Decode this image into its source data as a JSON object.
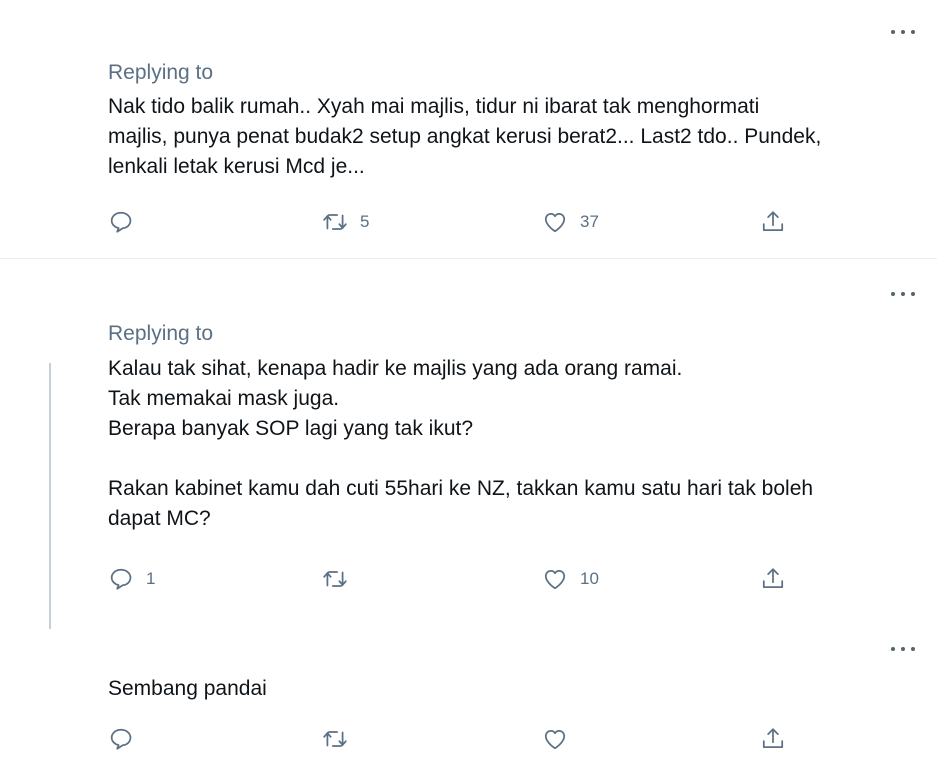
{
  "more_label": "More",
  "tweets": [
    {
      "replying_label": "Replying to",
      "text": "Nak tido balik rumah.. Xyah mai majlis, tidur ni ibarat tak menghormati\nmajlis, punya penat budak2 setup angkat kerusi berat2... Last2 tdo.. Pundek,\nlenkali letak kerusi Mcd je...",
      "reply_count": "",
      "retweet_count": "5",
      "like_count": "37"
    },
    {
      "replying_label": "Replying to",
      "text": "Kalau tak sihat, kenapa hadir ke majlis yang ada orang ramai.\nTak memakai mask juga.\nBerapa banyak SOP lagi yang tak ikut?\n\nRakan kabinet kamu dah cuti 55hari ke NZ, takkan kamu satu hari tak boleh\ndapat MC?",
      "reply_count": "1",
      "retweet_count": "",
      "like_count": "10"
    },
    {
      "replying_label": "",
      "text": "Sembang pandai",
      "reply_count": "",
      "retweet_count": "",
      "like_count": ""
    }
  ],
  "icons": {
    "reply": "speech-bubble-icon",
    "retweet": "retweet-arrows-icon",
    "like": "heart-outline-icon",
    "share": "share-upload-icon",
    "more": "ellipsis-icon"
  },
  "colors": {
    "secondary_text": "#5b7083",
    "primary_text": "#0f1419",
    "divider": "#ebeef0",
    "thread_line": "#c4cfd6"
  }
}
